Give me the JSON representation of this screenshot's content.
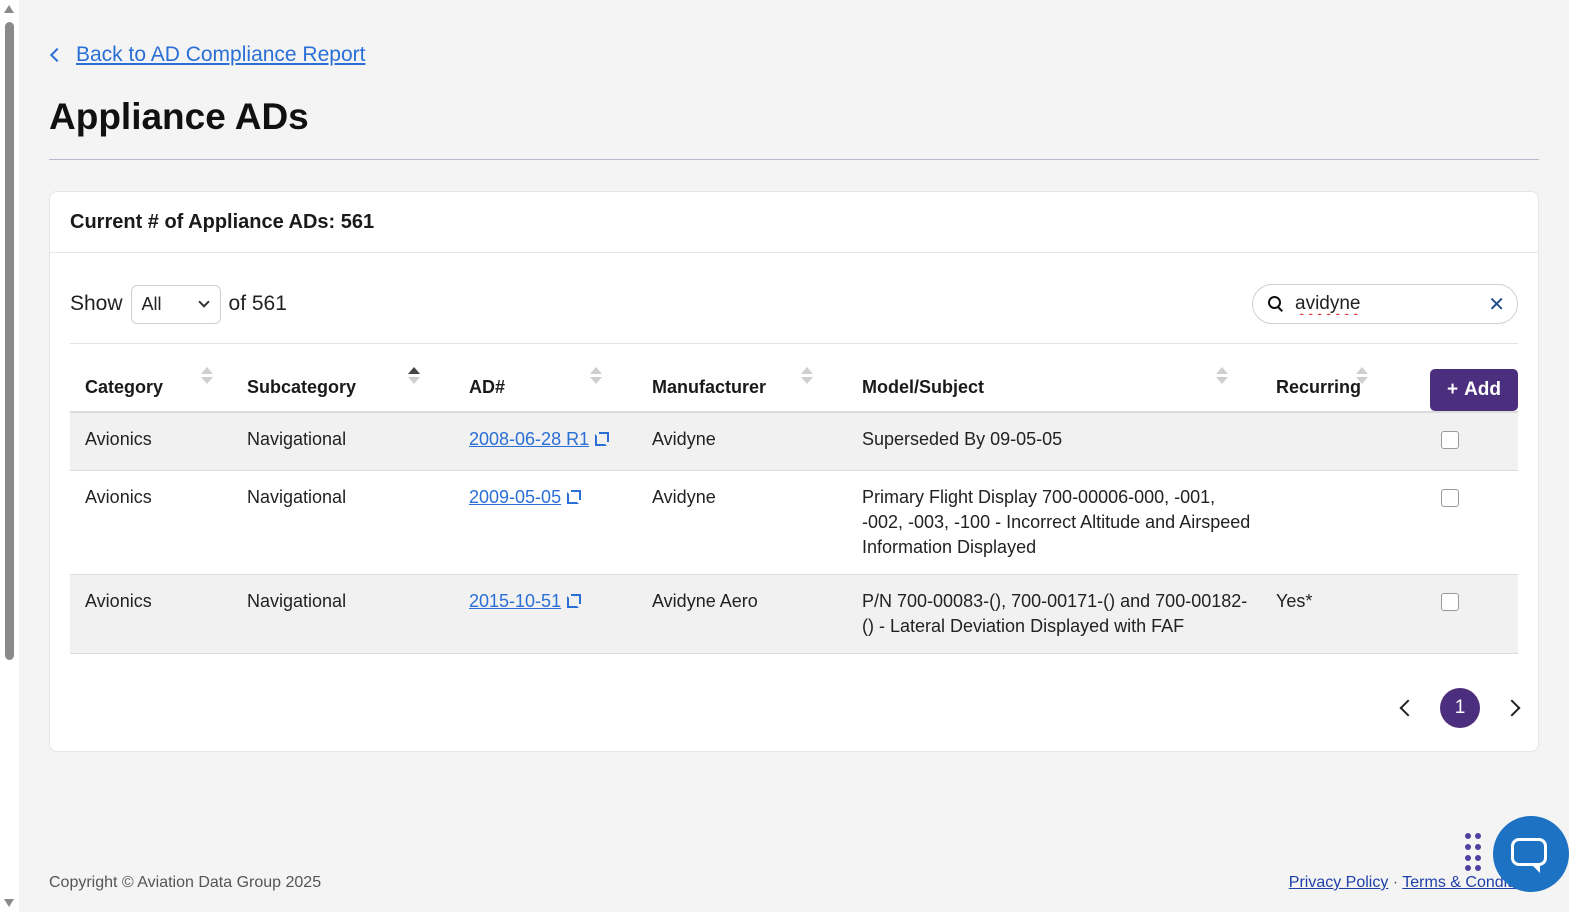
{
  "back_link": {
    "label": "Back to AD Compliance Report"
  },
  "page_title": "Appliance ADs",
  "card": {
    "header": "Current # of Appliance ADs: 561"
  },
  "controls": {
    "show_label": "Show",
    "show_value": "All",
    "of_label": "of 561",
    "search_value": "avidyne"
  },
  "table": {
    "columns": [
      "Category",
      "Subcategory",
      "AD#",
      "Manufacturer",
      "Model/Subject",
      "Recurring"
    ],
    "add_label": "Add",
    "rows": [
      {
        "category": "Avionics",
        "subcategory": "Navigational",
        "ad": "2008-06-28 R1",
        "manufacturer": "Avidyne",
        "model": "Superseded By 09-05-05",
        "recurring": ""
      },
      {
        "category": "Avionics",
        "subcategory": "Navigational",
        "ad": "2009-05-05",
        "manufacturer": "Avidyne",
        "model": "Primary Flight Display 700-00006-000, -001, -002, -003, -100 - Incorrect Altitude and Airspeed Information Displayed",
        "recurring": ""
      },
      {
        "category": "Avionics",
        "subcategory": "Navigational",
        "ad": "2015-10-51",
        "manufacturer": "Avidyne Aero",
        "model": "P/N 700-00083-(), 700-00171-() and 700-00182-() - Lateral Deviation Displayed with FAF",
        "recurring": "Yes*"
      }
    ]
  },
  "pagination": {
    "current_page": "1"
  },
  "footer": {
    "copyright": "Copyright © Aviation Data Group 2025",
    "privacy": "Privacy Policy",
    "separator": "·",
    "terms": "Terms & Conditions"
  },
  "colors": {
    "accent": "#4b2e7e",
    "link": "#2a6fd6",
    "chat": "#1d72c4"
  },
  "icons": [
    "chevron-left-icon",
    "search-icon",
    "clear-icon",
    "sort-icon",
    "external-link-icon",
    "plus-icon",
    "chat-icon",
    "drag-handle-icon"
  ]
}
